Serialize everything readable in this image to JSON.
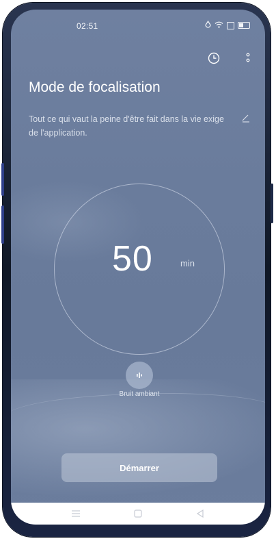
{
  "status_bar": {
    "time": "02:51",
    "icons": [
      "data-saver-icon",
      "wifi-icon",
      "sim-icon",
      "battery-icon"
    ]
  },
  "toolbar": {
    "history_icon": "clock-icon",
    "more_icon": "more-vertical-icon"
  },
  "page": {
    "title": "Mode de focalisation",
    "quote": "Tout ce qui vaut la peine d'être fait dans la vie exige de l'application."
  },
  "timer": {
    "value": "50",
    "unit": "min"
  },
  "ambient": {
    "label": "Bruit ambiant"
  },
  "actions": {
    "start_label": "Démarrer"
  },
  "nav": {
    "icons": [
      "menu-icon",
      "home-icon",
      "back-icon"
    ]
  },
  "colors": {
    "background": "#6c7e9e",
    "text": "#ffffff",
    "button": "#b9c3d4"
  }
}
